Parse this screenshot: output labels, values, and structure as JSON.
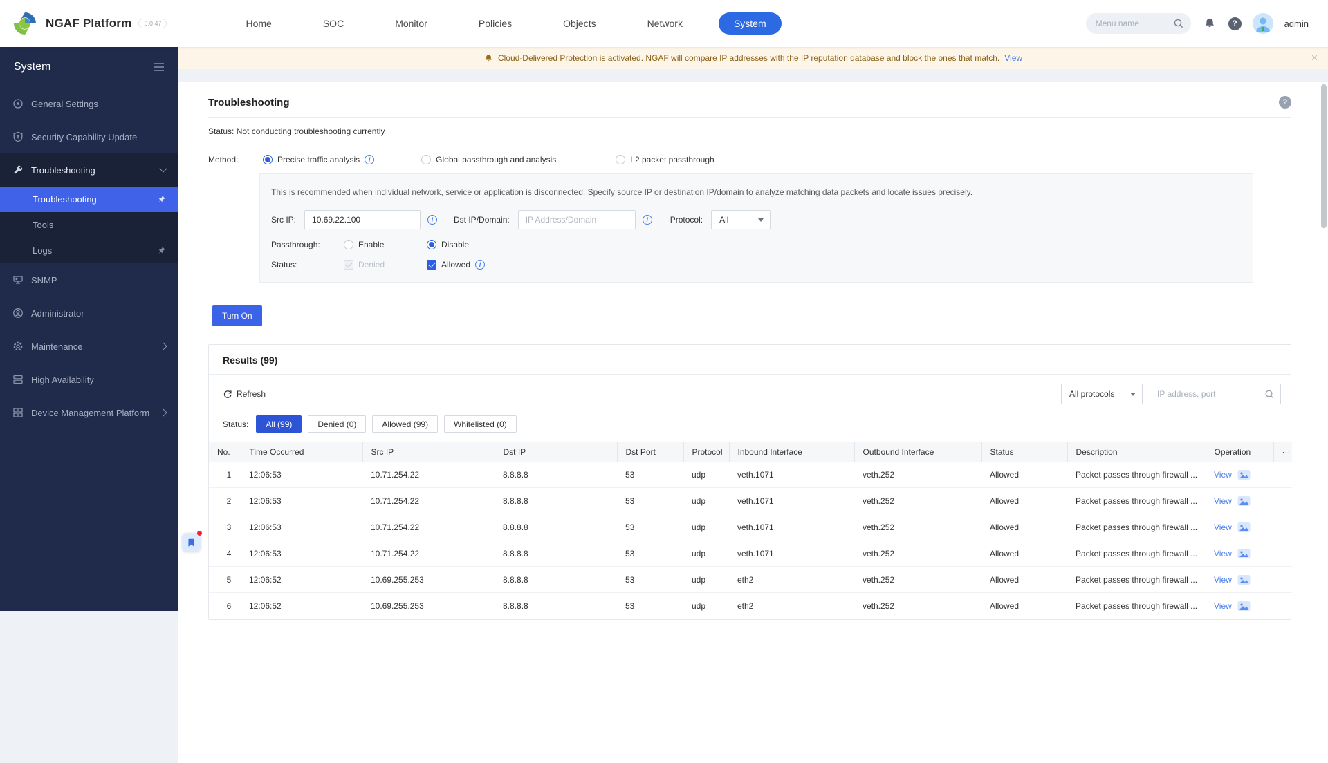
{
  "colors": {
    "accent": "#2e5fe0",
    "header_active": "#2b6ae3",
    "sidebar_bg": "#202b4b",
    "sidebar_sub_bg": "#1a2238",
    "selected_bg": "#3f62e8",
    "banner_bg": "#fdf6e8",
    "banner_text": "#8a6116",
    "green": "#3eae4f",
    "link": "#4a7fe8",
    "filter_active": "#2d54d4"
  },
  "header": {
    "brand": "NGAF Platform",
    "version": "8.0.47",
    "nav": [
      {
        "label": "Home"
      },
      {
        "label": "SOC"
      },
      {
        "label": "Monitor"
      },
      {
        "label": "Policies"
      },
      {
        "label": "Objects"
      },
      {
        "label": "Network"
      },
      {
        "label": "System",
        "active": true
      }
    ],
    "search_placeholder": "Menu name",
    "username": "admin"
  },
  "banner": {
    "text": "Cloud-Delivered Protection is activated. NGAF will compare IP addresses with the IP reputation database and block the ones that match.",
    "link_label": "View",
    "close_label": "✕"
  },
  "sidebar": {
    "title": "System",
    "items": [
      "General Settings",
      "Security Capability Update",
      "Troubleshooting",
      "SNMP",
      "Administrator",
      "Maintenance",
      "High Availability",
      "Device Management Platform"
    ],
    "submenu": [
      "Troubleshooting",
      "Tools",
      "Logs"
    ]
  },
  "page": {
    "title": "Troubleshooting",
    "status_line": "Status: Not conducting troubleshooting currently",
    "method_label": "Method:",
    "methods": [
      "Precise traffic analysis",
      "Global passthrough and analysis",
      "L2 packet passthrough"
    ],
    "panel": {
      "description": "This is recommended when individual network, service or application is disconnected. Specify source IP or destination IP/domain to analyze matching data packets and locate issues precisely.",
      "src_ip_label": "Src IP:",
      "src_ip_value": "10.69.22.100",
      "dst_label": "Dst IP/Domain:",
      "dst_placeholder": "IP Address/Domain",
      "protocol_label": "Protocol:",
      "protocol_value": "All",
      "passthrough_label": "Passthrough:",
      "enable_label": "Enable",
      "disable_label": "Disable",
      "status_label": "Status:",
      "denied_label": "Denied",
      "allowed_label": "Allowed"
    },
    "turn_on_label": "Turn On"
  },
  "results": {
    "title": "Results (99)",
    "refresh_label": "Refresh",
    "protocol_filter_value": "All protocols",
    "search_placeholder": "IP address, port",
    "status_filter_label": "Status:",
    "more_icon": "···",
    "filters": [
      {
        "label": "All (99)",
        "active": true
      },
      {
        "label": "Denied (0)"
      },
      {
        "label": "Allowed (99)"
      },
      {
        "label": "Whitelisted (0)"
      }
    ],
    "columns": [
      "No.",
      "Time Occurred",
      "Src IP",
      "Dst IP",
      "Dst Port",
      "Protocol",
      "Inbound Interface",
      "Outbound Interface",
      "Status",
      "Description",
      "Operation"
    ],
    "rows": [
      {
        "no": "1",
        "time": "12:06:53",
        "src_ip": "10.71.254.22",
        "dst_ip": "8.8.8.8",
        "dst_port": "53",
        "protocol": "udp",
        "inbound": "veth.1071",
        "outbound": "veth.252",
        "status": "Allowed",
        "description": "Packet passes through firewall ...",
        "operation": "View"
      },
      {
        "no": "2",
        "time": "12:06:53",
        "src_ip": "10.71.254.22",
        "dst_ip": "8.8.8.8",
        "dst_port": "53",
        "protocol": "udp",
        "inbound": "veth.1071",
        "outbound": "veth.252",
        "status": "Allowed",
        "description": "Packet passes through firewall ...",
        "operation": "View"
      },
      {
        "no": "3",
        "time": "12:06:53",
        "src_ip": "10.71.254.22",
        "dst_ip": "8.8.8.8",
        "dst_port": "53",
        "protocol": "udp",
        "inbound": "veth.1071",
        "outbound": "veth.252",
        "status": "Allowed",
        "description": "Packet passes through firewall ...",
        "operation": "View"
      },
      {
        "no": "4",
        "time": "12:06:53",
        "src_ip": "10.71.254.22",
        "dst_ip": "8.8.8.8",
        "dst_port": "53",
        "protocol": "udp",
        "inbound": "veth.1071",
        "outbound": "veth.252",
        "status": "Allowed",
        "description": "Packet passes through firewall ...",
        "operation": "View"
      },
      {
        "no": "5",
        "time": "12:06:52",
        "src_ip": "10.69.255.253",
        "dst_ip": "8.8.8.8",
        "dst_port": "53",
        "protocol": "udp",
        "inbound": "eth2",
        "outbound": "veth.252",
        "status": "Allowed",
        "description": "Packet passes through firewall ...",
        "operation": "View"
      },
      {
        "no": "6",
        "time": "12:06:52",
        "src_ip": "10.69.255.253",
        "dst_ip": "8.8.8.8",
        "dst_port": "53",
        "protocol": "udp",
        "inbound": "eth2",
        "outbound": "veth.252",
        "status": "Allowed",
        "description": "Packet passes through firewall ...",
        "operation": "View"
      }
    ]
  }
}
